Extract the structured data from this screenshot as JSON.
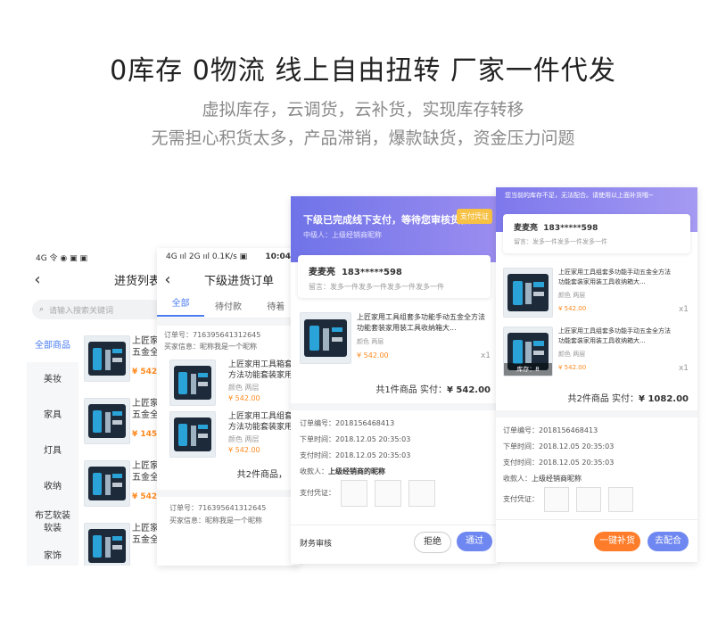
{
  "hero": {
    "title": "0库存 0物流 线上自由扭转 厂家一件代发",
    "line1": "虚拟库存，云调货，云补货，实现库存转移",
    "line2": "无需担心积货太多，产品滞销，爆款缺货，资金压力问题"
  },
  "colors": {
    "purple": "#8b86ee",
    "orange": "#ff8a1e",
    "blue": "#4a7cf0"
  },
  "phone1": {
    "status": "4G 令 ◉ ▣ ▣",
    "title": "进货列表",
    "search_placeholder": "请输入搜索关键词",
    "categories": [
      "全部商品",
      "美妆",
      "家具",
      "灯具",
      "收纳",
      "布艺软装",
      "软装",
      "家饰"
    ],
    "products": [
      {
        "name_a": "上匠家",
        "name_b": "五金全",
        "price": "¥ 5427"
      },
      {
        "name_a": "上匠家",
        "name_b": "五金全",
        "price": "¥ 1459"
      },
      {
        "name_a": "上匠家",
        "name_b": "五金全",
        "price": "¥ 542."
      },
      {
        "name_a": "上匠家",
        "name_b": "五金全",
        "price": ""
      }
    ]
  },
  "phone2": {
    "status_left": "4G ııl 2G ııl 0.1K/s ▣",
    "status_time": "10:04",
    "title": "下级进货订单",
    "tabs": [
      "全部",
      "待付款",
      "待着"
    ],
    "order1": {
      "order_no": "订单号：716395641312645",
      "buyer": "买家信息：昵称我是一个昵称",
      "items": [
        {
          "name": "上匠家用工具箱套",
          "desc": "方法功能套装家用",
          "spec": "颜色 两层",
          "price": "¥ 542.00"
        },
        {
          "name": "上匠家用工具组套",
          "desc": "方法功能套装家用",
          "spec": "颜色 两层",
          "price": "¥ 542.00"
        }
      ],
      "summary": "共2件商品，"
    },
    "order2": {
      "order_no": "订单号：716395641312645",
      "buyer": "买家信息：昵称我是一个昵称"
    }
  },
  "phone3": {
    "banner_title": "下级已完成线下支付，等待您审核货款",
    "banner_btn": "支付凭证",
    "banner_sub": "中级人：上级经销商昵称",
    "contact_name": "麦麦亮",
    "contact_phone": "183*****598",
    "contact_note": "留言：发多一件发多一件发多一件发多一件",
    "item": {
      "name": "上匠家用工具组套多功能手动五金全方法",
      "desc": "功能套装家用装工具收纳箱大...",
      "spec": "颜色 两层",
      "price": "¥ 542.00",
      "qty": "x1"
    },
    "total_label": "共1件商品  实付：",
    "total_value": "¥ 542.00",
    "info": [
      {
        "label": "订单编号：",
        "value": "2018156468413"
      },
      {
        "label": "下单时间：",
        "value": "2018.12.05 20:35:03"
      },
      {
        "label": "支付时间：",
        "value": "2018.12.05 20:35:03"
      },
      {
        "label": "收款人：",
        "value": "上级经销商的昵称"
      },
      {
        "label": "支付凭证：",
        "value": ""
      }
    ],
    "footer_label": "财务审核",
    "btn_reject": "拒绝",
    "btn_approve": "通过"
  },
  "phone4": {
    "notice": "您当前的库存不足，无法配合。请使用以上面补货哦~",
    "contact_name": "麦麦亮",
    "contact_phone": "183*****598",
    "contact_note": "留言：发多一件发多一件发多一件",
    "items": [
      {
        "name": "上匠家用工具组套多功能手动五金全方法",
        "desc": "功能套装家用装工具收纳箱大...",
        "spec": "颜色 两层",
        "price": "¥ 542.00",
        "qty": "x1",
        "badge": ""
      },
      {
        "name": "上匠家用工具组套多功能手动五金全方法",
        "desc": "功能套装家用装工具收纳箱大...",
        "spec": "颜色 两层",
        "price": "¥ 542.00",
        "qty": "x1",
        "badge": "库存：8"
      }
    ],
    "total_label": "共2件商品  实付：",
    "total_value": "¥ 1082.00",
    "info": [
      {
        "label": "订单编号：",
        "value": "2018156468413"
      },
      {
        "label": "下单时间：",
        "value": "2018.12.05 20:35:03"
      },
      {
        "label": "支付时间：",
        "value": "2018.12.05 20:35:03"
      },
      {
        "label": "收款人：",
        "value": "上级经销商昵称"
      },
      {
        "label": "支付凭证：",
        "value": ""
      }
    ],
    "btn_restock": "一键补货",
    "btn_match": "去配合"
  }
}
